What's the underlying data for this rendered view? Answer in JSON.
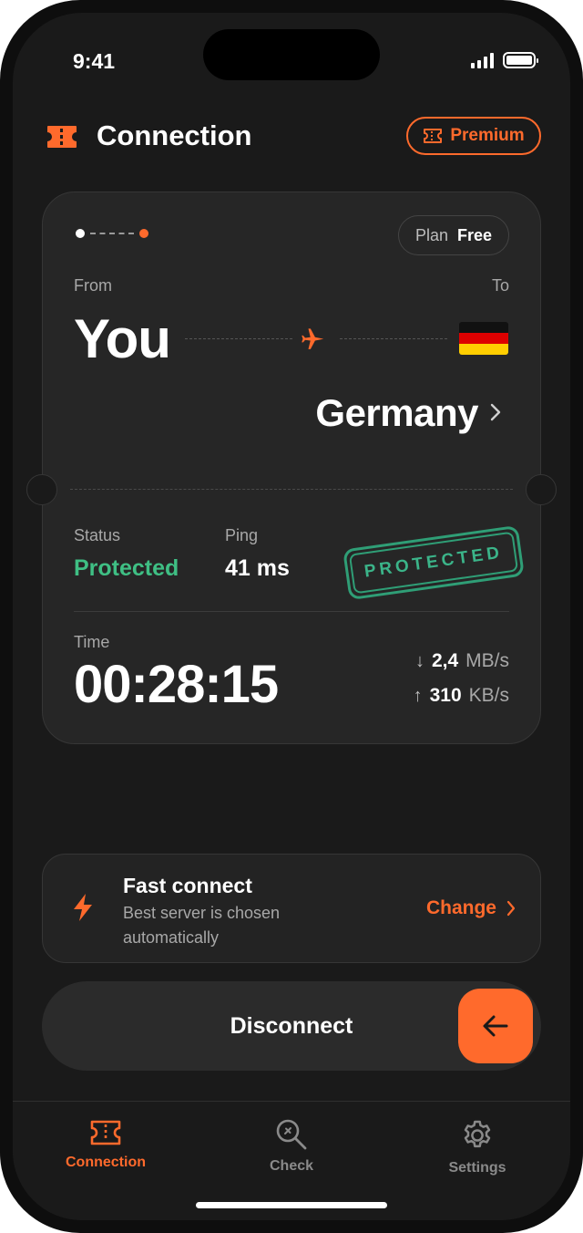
{
  "status_bar": {
    "time": "9:41"
  },
  "header": {
    "title": "Connection",
    "premium_label": "Premium"
  },
  "connection_card": {
    "plan_label": "Plan",
    "plan_value": "Free",
    "from_label": "From",
    "to_label": "To",
    "from_value": "You",
    "destination": "Germany",
    "status_label": "Status",
    "status_value": "Protected",
    "ping_label": "Ping",
    "ping_value": "41 ms",
    "stamp_text": "PROTECTED",
    "time_label": "Time",
    "time_value": "00:28:15",
    "download": {
      "value": "2,4",
      "unit": "MB/s"
    },
    "upload": {
      "value": "310",
      "unit": "KB/s"
    }
  },
  "fast_connect": {
    "title": "Fast connect",
    "subtitle": "Best server is chosen automatically",
    "action_label": "Change"
  },
  "disconnect": {
    "label": "Disconnect"
  },
  "tabs": [
    {
      "label": "Connection",
      "icon": "ticket-icon",
      "active": true
    },
    {
      "label": "Check",
      "icon": "magnifier-icon",
      "active": false
    },
    {
      "label": "Settings",
      "icon": "gear-icon",
      "active": false
    }
  ],
  "colors": {
    "accent": "#ff6a2c",
    "success": "#3fbf84",
    "background": "#1a1a1a",
    "card": "#262626"
  }
}
